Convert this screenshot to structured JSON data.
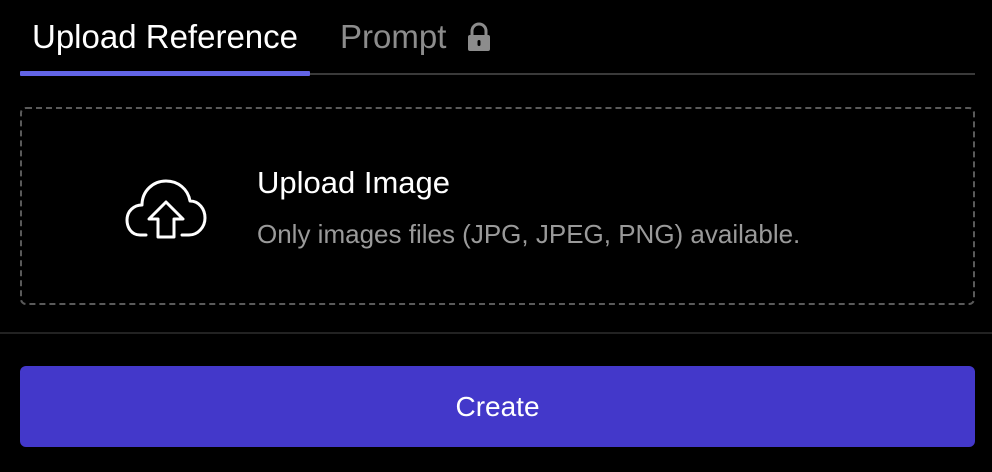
{
  "tabs": [
    {
      "label": "Upload Reference",
      "active": true
    },
    {
      "label": "Prompt",
      "active": false,
      "icon": "lock-icon"
    }
  ],
  "upload": {
    "icon": "cloud-upload-icon",
    "title": "Upload Image",
    "hint": "Only images files (JPG, JPEG, PNG) available."
  },
  "actions": {
    "create_label": "Create"
  },
  "colors": {
    "background": "#000000",
    "active_tab_indicator": "#6264e6",
    "primary_button": "#4338ca",
    "muted_text": "#9a9a9a"
  }
}
